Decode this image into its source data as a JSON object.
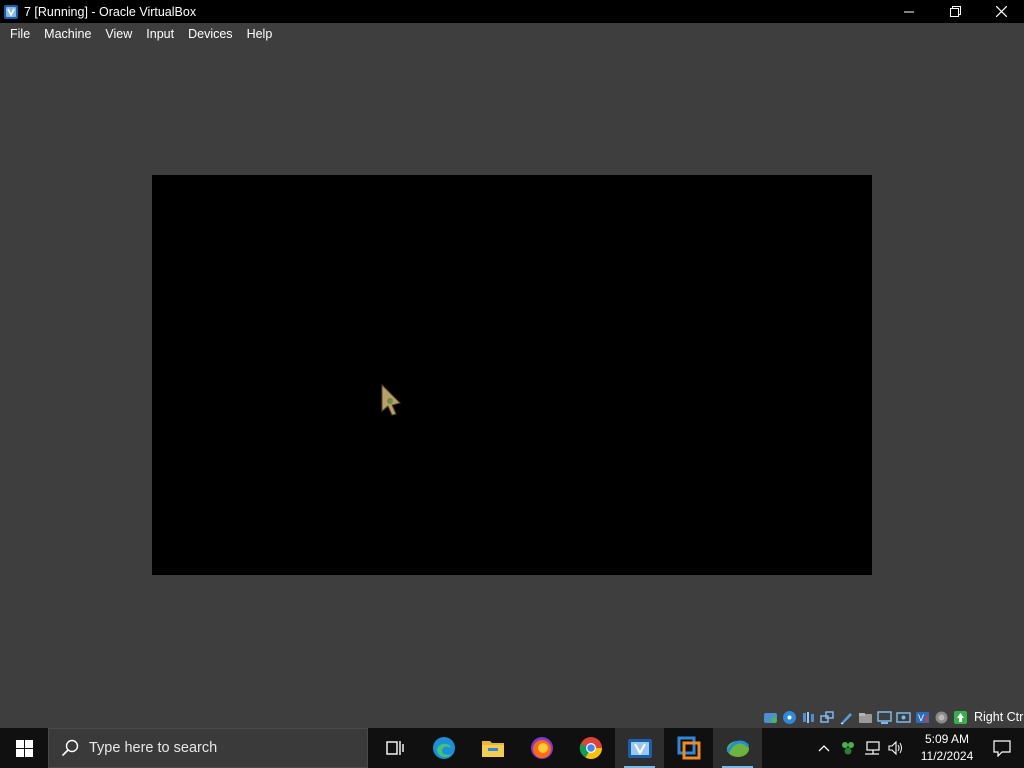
{
  "window": {
    "title": "7 [Running] - Oracle VirtualBox",
    "icon": "virtualbox-icon"
  },
  "menu": [
    "File",
    "Machine",
    "View",
    "Input",
    "Devices",
    "Help"
  ],
  "status_bar": {
    "icons": [
      "hard-disk-icon",
      "optical-disk-icon",
      "audio-icon",
      "network-icon",
      "usb-icon",
      "shared-folders-icon",
      "display-icon",
      "recording-icon",
      "cpu-icon",
      "mouse-integration-icon",
      "keyboard-icon"
    ],
    "host_key": "Right Ctrl"
  },
  "taskbar": {
    "search_placeholder": "Type here to search",
    "apps": [
      "task-view-icon",
      "edge-icon",
      "file-explorer-icon",
      "firefox-icon",
      "chrome-icon",
      "virtualbox-manager-icon",
      "vmware-icon",
      "virtualbox-vm-icon"
    ],
    "time": "5:09 AM",
    "date": "11/2/2024"
  },
  "colors": {
    "frame_bg": "#3e3e3e",
    "titlebar_bg": "#000000",
    "guest_bg": "#000000",
    "taskbar_bg": "#101010",
    "accent": "#76b9ed"
  }
}
